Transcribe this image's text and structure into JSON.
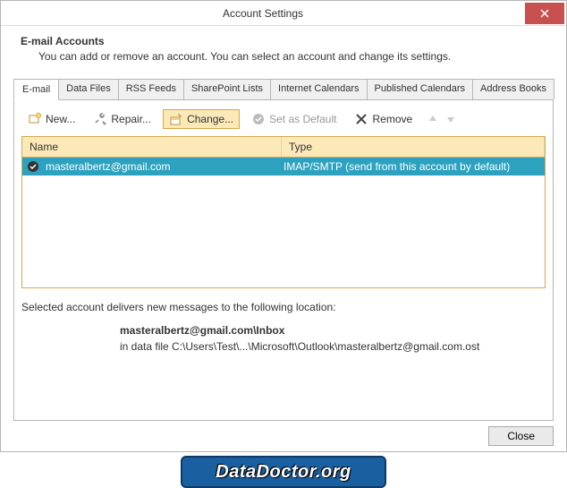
{
  "title": "Account Settings",
  "header": {
    "heading": "E-mail Accounts",
    "subheading": "You can add or remove an account. You can select an account and change its settings."
  },
  "tabs": [
    {
      "label": "E-mail",
      "active": true
    },
    {
      "label": "Data Files"
    },
    {
      "label": "RSS Feeds"
    },
    {
      "label": "SharePoint Lists"
    },
    {
      "label": "Internet Calendars"
    },
    {
      "label": "Published Calendars"
    },
    {
      "label": "Address Books"
    }
  ],
  "toolbar": {
    "new": "New...",
    "repair": "Repair...",
    "change": "Change...",
    "set_default": "Set as Default",
    "remove": "Remove"
  },
  "list": {
    "headers": {
      "name": "Name",
      "type": "Type"
    },
    "rows": [
      {
        "name": "masteralbertz@gmail.com",
        "type": "IMAP/SMTP (send from this account by default)"
      }
    ]
  },
  "delivery": {
    "intro": "Selected account delivers new messages to the following location:",
    "folder": "masteralbertz@gmail.com\\Inbox",
    "path": "in data file C:\\Users\\Test\\...\\Microsoft\\Outlook\\masteralbertz@gmail.com.ost"
  },
  "footer": {
    "close": "Close"
  },
  "watermark": "DataDoctor.org"
}
